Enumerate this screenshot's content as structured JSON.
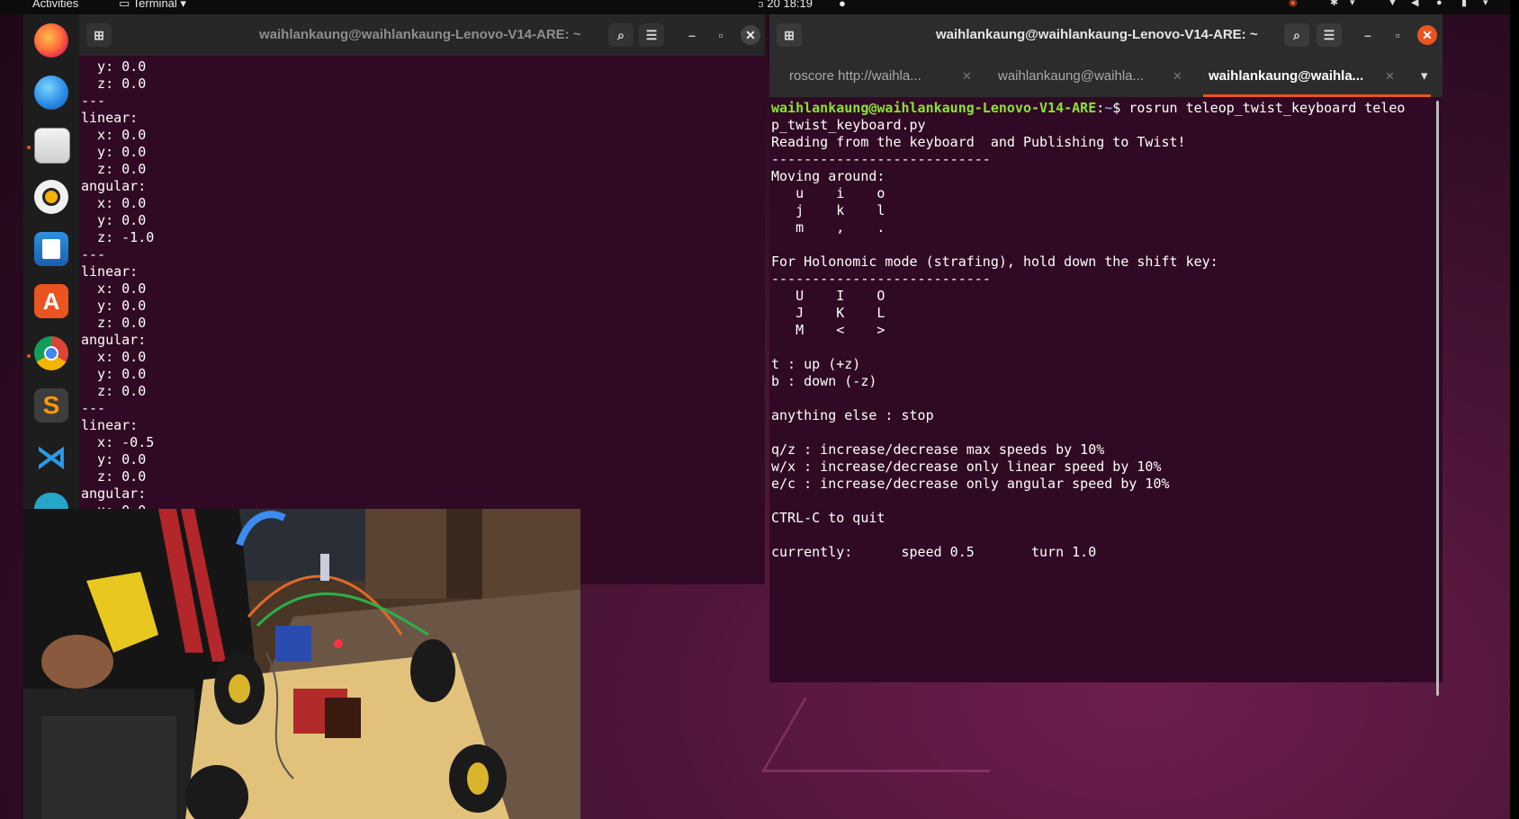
{
  "topbar": {
    "activities": "Activities",
    "app_menu": "Terminal",
    "clock": "ဒ 20  18:19"
  },
  "dock": {
    "apps": [
      "firefox-icon",
      "thunderbird-icon",
      "files-icon",
      "rhythmbox-icon",
      "writer-icon",
      "software-icon",
      "chrome-icon",
      "sublime-icon",
      "vscode-icon"
    ]
  },
  "left_terminal": {
    "title": "waihlankaung@waihlankaung-Lenovo-V14-ARE: ~",
    "output": "  y: 0.0\n  z: 0.0\n---\nlinear:\n  x: 0.0\n  y: 0.0\n  z: 0.0\nangular:\n  x: 0.0\n  y: 0.0\n  z: -1.0\n---\nlinear:\n  x: 0.0\n  y: 0.0\n  z: 0.0\nangular:\n  x: 0.0\n  y: 0.0\n  z: 0.0\n---\nlinear:\n  x: -0.5\n  y: 0.0\n  z: 0.0\nangular:\n  x: 0.0"
  },
  "right_terminal": {
    "title": "waihlankaung@waihlankaung-Lenovo-V14-ARE: ~",
    "tabs": [
      {
        "label": "roscore http://waihla..."
      },
      {
        "label": "waihlankaung@waihla..."
      },
      {
        "label": "waihlankaung@waihla..."
      }
    ],
    "prompt_user": "waihlankaung@waihlankaung-Lenovo-V14-ARE",
    "prompt_sep": ":",
    "prompt_path": "~",
    "prompt_cmd": "$ rosrun teleop_twist_keyboard teleo\np_twist_keyboard.py",
    "output": "\nReading from the keyboard  and Publishing to Twist!\n---------------------------\nMoving around:\n   u    i    o\n   j    k    l\n   m    ,    .\n\nFor Holonomic mode (strafing), hold down the shift key:\n---------------------------\n   U    I    O\n   J    K    L\n   M    <    >\n\nt : up (+z)\nb : down (-z)\n\nanything else : stop\n\nq/z : increase/decrease max speeds by 10%\nw/x : increase/decrease only linear speed by 10%\ne/c : increase/decrease only angular speed by 10%\n\nCTRL-C to quit\n\ncurrently:\tspeed 0.5\tturn 1.0"
  },
  "colors": {
    "terminal_bg": "#300a24",
    "header_bg": "#2c2c2c",
    "accent": "#e95420",
    "prompt_green": "#8ae234",
    "prompt_blue": "#729fcf"
  }
}
